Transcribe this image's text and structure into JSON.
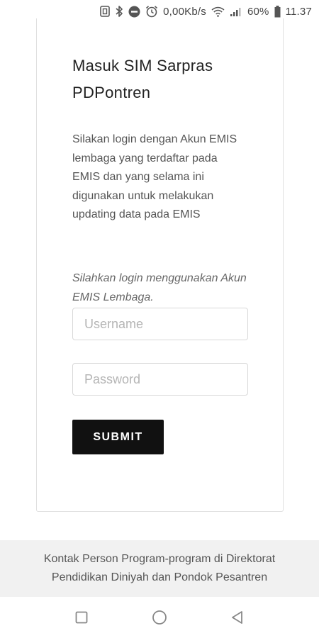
{
  "status_bar": {
    "network_speed": "0,00Kb/s",
    "battery_percent": "60%",
    "time": "11.37",
    "icons": [
      "nfc-icon",
      "bluetooth-icon",
      "do-not-disturb-icon",
      "alarm-icon",
      "wifi-icon",
      "signal-icon",
      "battery-icon"
    ]
  },
  "login": {
    "title": "Masuk SIM Sarpras PDPontren",
    "description": "Silakan login dengan Akun EMIS lembaga yang terdaftar pada EMIS dan yang selama ini digunakan untuk melakukan updating data pada EMIS",
    "hint": "Silahkan login menggunakan Akun EMIS Lembaga.",
    "username": {
      "placeholder": "Username",
      "value": ""
    },
    "password": {
      "placeholder": "Password",
      "value": ""
    },
    "submit_label": "SUBMIT"
  },
  "footer": {
    "text": "Kontak Person Program-program di Direktorat Pendidikan Diniyah dan Pondok Pesantren"
  },
  "nav_bar": {
    "icons": [
      "recent-apps-icon",
      "home-icon",
      "back-icon"
    ]
  },
  "colors": {
    "submit_bg": "#111111",
    "footer_bg": "#f1f1f1"
  }
}
